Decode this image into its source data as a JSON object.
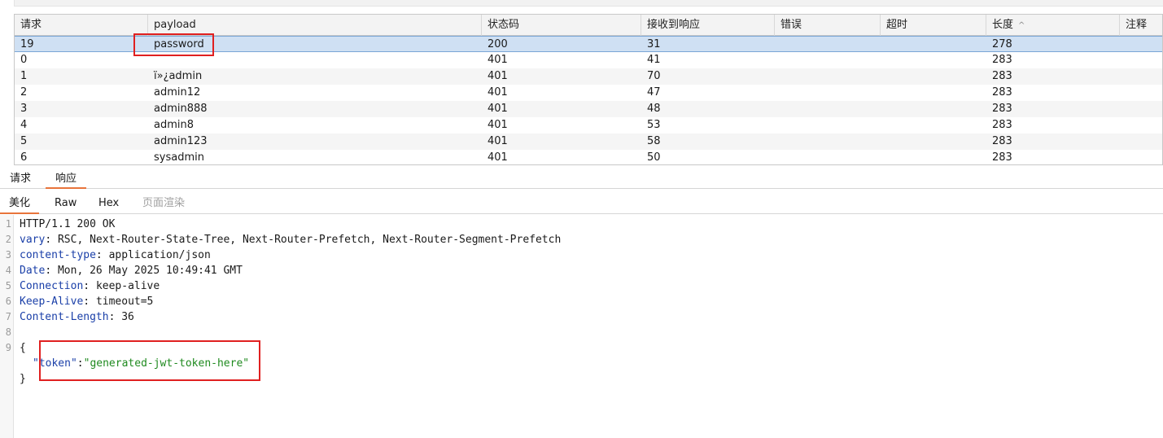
{
  "table": {
    "columns": [
      "请求",
      "payload",
      "状态码",
      "接收到响应",
      "错误",
      "超时",
      "长度",
      "注释"
    ],
    "sort_indicator": "^",
    "rows": [
      {
        "request": "19",
        "payload": "password",
        "status": "200",
        "received": "31",
        "error": "",
        "timeout": "",
        "length": "278",
        "comment": ""
      },
      {
        "request": "0",
        "payload": "",
        "status": "401",
        "received": "41",
        "error": "",
        "timeout": "",
        "length": "283",
        "comment": ""
      },
      {
        "request": "1",
        "payload": "ï»¿admin",
        "status": "401",
        "received": "70",
        "error": "",
        "timeout": "",
        "length": "283",
        "comment": ""
      },
      {
        "request": "2",
        "payload": "admin12",
        "status": "401",
        "received": "47",
        "error": "",
        "timeout": "",
        "length": "283",
        "comment": ""
      },
      {
        "request": "3",
        "payload": "admin888",
        "status": "401",
        "received": "48",
        "error": "",
        "timeout": "",
        "length": "283",
        "comment": ""
      },
      {
        "request": "4",
        "payload": "admin8",
        "status": "401",
        "received": "53",
        "error": "",
        "timeout": "",
        "length": "283",
        "comment": ""
      },
      {
        "request": "5",
        "payload": "admin123",
        "status": "401",
        "received": "58",
        "error": "",
        "timeout": "",
        "length": "283",
        "comment": ""
      },
      {
        "request": "6",
        "payload": "sysadmin",
        "status": "401",
        "received": "50",
        "error": "",
        "timeout": "",
        "length": "283",
        "comment": ""
      }
    ]
  },
  "detail_tabs": [
    "请求",
    "响应"
  ],
  "view_tabs": [
    "美化",
    "Raw",
    "Hex",
    "页面渲染"
  ],
  "response": {
    "line1": "HTTP/1.1 200 OK",
    "headers": [
      {
        "name": "vary",
        "value": "RSC, Next-Router-State-Tree, Next-Router-Prefetch, Next-Router-Segment-Prefetch"
      },
      {
        "name": "content-type",
        "value": "application/json"
      },
      {
        "name": "Date",
        "value": "Mon, 26 May 2025 10:49:41 GMT"
      },
      {
        "name": "Connection",
        "value": "keep-alive"
      },
      {
        "name": "Keep-Alive",
        "value": "timeout=5"
      },
      {
        "name": "Content-Length",
        "value": "36"
      }
    ],
    "body_open": "{",
    "body_key": "\"token\"",
    "body_sep": ":",
    "body_value": "\"generated-jwt-token-here\"",
    "body_close": "}",
    "line_numbers": [
      "1",
      "2",
      "3",
      "4",
      "5",
      "6",
      "7",
      "8",
      "9"
    ]
  },
  "colors": {
    "selected_row": "#cfe0f3",
    "tab_accent": "#e8743b",
    "annotation": "#e02020",
    "header_key": "#1a3fa8",
    "json_string": "#1f8a1f"
  }
}
